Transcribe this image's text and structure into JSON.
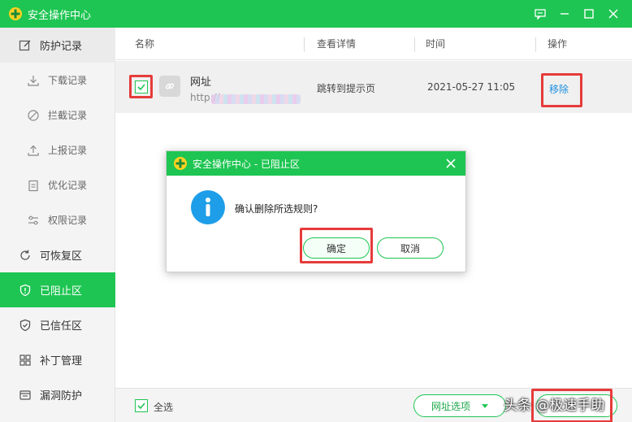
{
  "window": {
    "title": "安全操作中心",
    "accent_color": "#1ec552",
    "highlight_color": "#e63b3b"
  },
  "sidebar": {
    "items": [
      {
        "label": "防护记录",
        "icon": "edit-icon"
      },
      {
        "label": "下载记录",
        "icon": "download-icon"
      },
      {
        "label": "拦截记录",
        "icon": "block-icon"
      },
      {
        "label": "上报记录",
        "icon": "upload-icon"
      },
      {
        "label": "优化记录",
        "icon": "clipboard-icon"
      },
      {
        "label": "权限记录",
        "icon": "sliders-icon"
      },
      {
        "label": "可恢复区",
        "icon": "restore-icon"
      },
      {
        "label": "已阻止区",
        "icon": "shield-block-icon",
        "active": true
      },
      {
        "label": "已信任区",
        "icon": "shield-check-icon"
      },
      {
        "label": "补丁管理",
        "icon": "grid-icon"
      },
      {
        "label": "漏洞防护",
        "icon": "bug-shield-icon"
      }
    ]
  },
  "table": {
    "columns": [
      "名称",
      "查看详情",
      "时间",
      "操作"
    ],
    "rows": [
      {
        "checked": true,
        "name": "网址",
        "url": "http://",
        "detail": "跳转到提示页",
        "time": "2021-05-27 11:05",
        "action": "移除"
      }
    ]
  },
  "bottombar": {
    "select_all": "全选",
    "url_options": "网址选项"
  },
  "dialog": {
    "title": "安全操作中心 - 已阻止区",
    "message": "确认删除所选规则?",
    "confirm": "确定",
    "cancel": "取消"
  },
  "watermark": "头条 @极速手助"
}
